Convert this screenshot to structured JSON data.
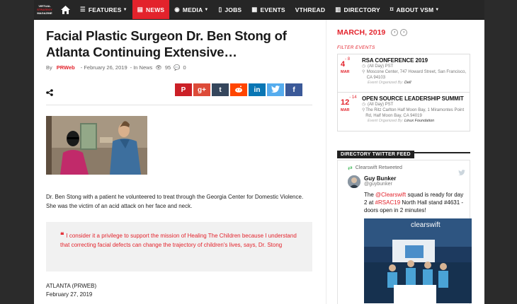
{
  "nav": {
    "logo_lines": [
      "VIRTUAL",
      "STRATEGY",
      "MAGAZINE"
    ],
    "items": [
      {
        "label": "FEATURES",
        "icon": "list-icon",
        "has_caret": true
      },
      {
        "label": "NEWS",
        "icon": "newspaper-icon",
        "has_caret": false,
        "active": true
      },
      {
        "label": "MEDIA",
        "icon": "play-circle-icon",
        "has_caret": true
      },
      {
        "label": "JOBS",
        "icon": "phone-icon",
        "has_caret": false
      },
      {
        "label": "EVENTS",
        "icon": "calendar-icon",
        "has_caret": false
      },
      {
        "label": "VTHREAD",
        "icon": "",
        "has_caret": false
      },
      {
        "label": "DIRECTORY",
        "icon": "book-icon",
        "has_caret": false
      },
      {
        "label": "ABOUT VSM",
        "icon": "bookmark-icon",
        "has_caret": true
      }
    ]
  },
  "article": {
    "title": "Facial Plastic Surgeon Dr. Ben Stong of Atlanta Continuing Extensive…",
    "by": "By",
    "author": "PRWeb",
    "date": "- February 26, 2019",
    "category": "- In News",
    "views": "95",
    "comments": "0",
    "caption": "Dr. Ben Stong with a patient he volunteered to treat through the Georgia Center for Domestic Violence. She was the victim of an acid attack on her face and neck.",
    "quote": "I consider it a privilege to support the mission of Healing The Children because I understand that correcting facial defects can change the trajectory of children's lives, says, Dr. Stong",
    "dateline_1": "ATLANTA (PRWEB)",
    "dateline_2": "February 27, 2019"
  },
  "social": [
    {
      "name": "pinterest",
      "glyph": "P",
      "color": "#cb2027"
    },
    {
      "name": "google-plus",
      "glyph": "g+",
      "color": "#dd4b39"
    },
    {
      "name": "tumblr",
      "glyph": "t",
      "color": "#35465c"
    },
    {
      "name": "reddit",
      "glyph": "r",
      "color": "#ff4500"
    },
    {
      "name": "linkedin",
      "glyph": "in",
      "color": "#0976b4"
    },
    {
      "name": "twitter",
      "glyph": "t",
      "color": "#55acee"
    },
    {
      "name": "facebook",
      "glyph": "f",
      "color": "#3b5998"
    }
  ],
  "calendar": {
    "month": "MARCH, 2019",
    "filter": "FILTER EVENTS",
    "events": [
      {
        "day": "4",
        "end": "- 8",
        "mon": "MAR",
        "title": "RSA CONFERENCE 2019",
        "time": "(All Day) PST",
        "location": "Moscone Center, 747 Howard Street, San Francisco, CA 94103",
        "org_label": "Event Organized By:",
        "org": "Dell"
      },
      {
        "day": "12",
        "end": "- 14",
        "mon": "MAR",
        "title": "OPEN SOURCE LEADERSHIP SUMMIT",
        "time": "(All Day) PST",
        "location": "The Ritz Carlton Half Moon Bay, 1 Miramontes Point Rd, Half Moon Bay, CA 94019",
        "org_label": "Event Organized By:",
        "org": "Linux Foundation"
      }
    ]
  },
  "twitter": {
    "heading": "DIRECTORY TWITTER FEED",
    "retweeted": "Clearswift Retweeted",
    "name": "Guy Bunker",
    "handle": "@guybunker",
    "text_1": "The ",
    "mention": "@Clearswift",
    "text_2": " squad is ready for day 2 at ",
    "hashtag": "#RSAC19",
    "text_3": " North Hall stand #4631 - doors open in 2 minutes!",
    "booth_brand": "clearswift"
  },
  "colors": {
    "accent": "#e3232c",
    "nav_bg": "#262626"
  }
}
